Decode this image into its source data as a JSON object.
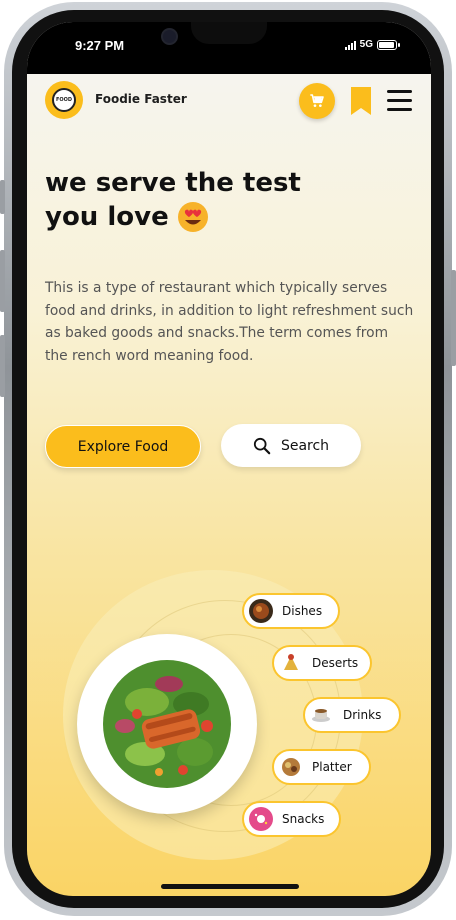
{
  "status": {
    "time": "9:27 PM",
    "network": "5G"
  },
  "header": {
    "brand": "Foodie Faster",
    "logo_text": "FOOD",
    "icons": {
      "cart": "cart-icon",
      "bookmark": "bookmark-icon",
      "menu": "menu-icon"
    }
  },
  "hero": {
    "line1": "we serve the test",
    "line2": "you love",
    "emoji": "heart-eyes-emoji"
  },
  "description": "This is a type of restaurant which typically serves food and drinks, in addition to light refreshment such as baked goods and snacks.The term comes from the rench word meaning food.",
  "buttons": {
    "explore": "Explore Food",
    "search": "Search"
  },
  "categories": [
    {
      "label": "Dishes",
      "icon": "dish-icon"
    },
    {
      "label": "Deserts",
      "icon": "dessert-icon"
    },
    {
      "label": "Drinks",
      "icon": "coffee-icon"
    },
    {
      "label": "Platter",
      "icon": "platter-icon"
    },
    {
      "label": "Snacks",
      "icon": "donut-icon"
    }
  ],
  "colors": {
    "accent": "#fbbd1c",
    "text": "#111111",
    "muted": "#555555"
  }
}
